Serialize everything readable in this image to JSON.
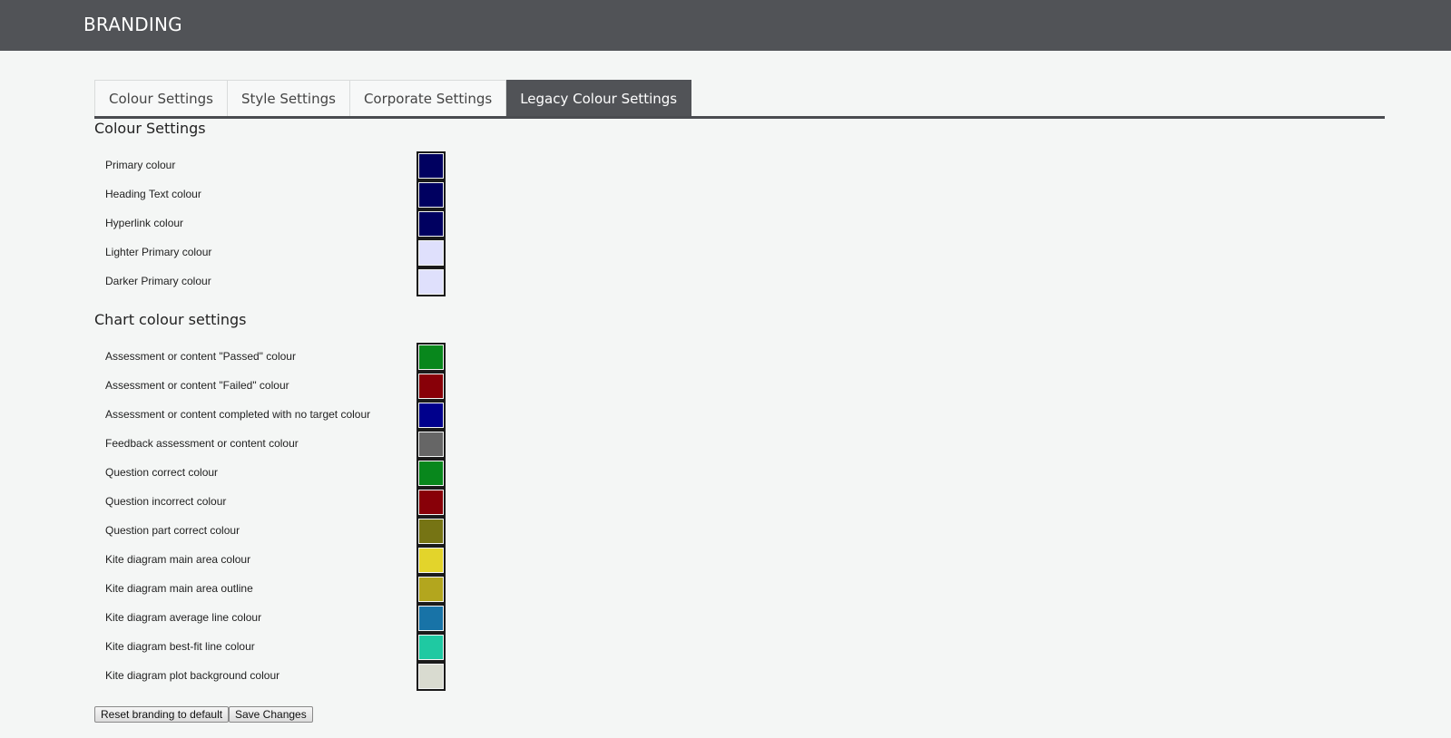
{
  "header": {
    "title": "BRANDING"
  },
  "tabs": [
    {
      "label": "Colour Settings",
      "active": false
    },
    {
      "label": "Style Settings",
      "active": false
    },
    {
      "label": "Corporate Settings",
      "active": false
    },
    {
      "label": "Legacy Colour Settings",
      "active": true
    }
  ],
  "colour_settings": {
    "title": "Colour Settings",
    "items": [
      {
        "label": "Primary colour",
        "color": "#000060"
      },
      {
        "label": "Heading Text colour",
        "color": "#000060"
      },
      {
        "label": "Hyperlink colour",
        "color": "#000060"
      },
      {
        "label": "Lighter Primary colour",
        "color": "#dfe0fc"
      },
      {
        "label": "Darker Primary colour",
        "color": "#dfe0fc"
      }
    ]
  },
  "chart_colour_settings": {
    "title": "Chart colour settings",
    "items": [
      {
        "label": "Assessment or content \"Passed\" colour",
        "color": "#08871c"
      },
      {
        "label": "Assessment or content \"Failed\" colour",
        "color": "#880008"
      },
      {
        "label": "Assessment or content completed with no target colour",
        "color": "#00008c"
      },
      {
        "label": "Feedback assessment or content colour",
        "color": "#666666"
      },
      {
        "label": "Question correct colour",
        "color": "#08871c"
      },
      {
        "label": "Question incorrect colour",
        "color": "#880008"
      },
      {
        "label": "Question part correct colour",
        "color": "#767414"
      },
      {
        "label": "Kite diagram main area colour",
        "color": "#e3d42b"
      },
      {
        "label": "Kite diagram main area outline",
        "color": "#b3a61e"
      },
      {
        "label": "Kite diagram average line colour",
        "color": "#1873a7"
      },
      {
        "label": "Kite diagram best-fit line colour",
        "color": "#1fc9a2"
      },
      {
        "label": "Kite diagram plot background colour",
        "color": "#d9dbd0"
      }
    ]
  },
  "buttons": {
    "reset_label": "Reset branding to default",
    "save_label": "Save Changes"
  }
}
